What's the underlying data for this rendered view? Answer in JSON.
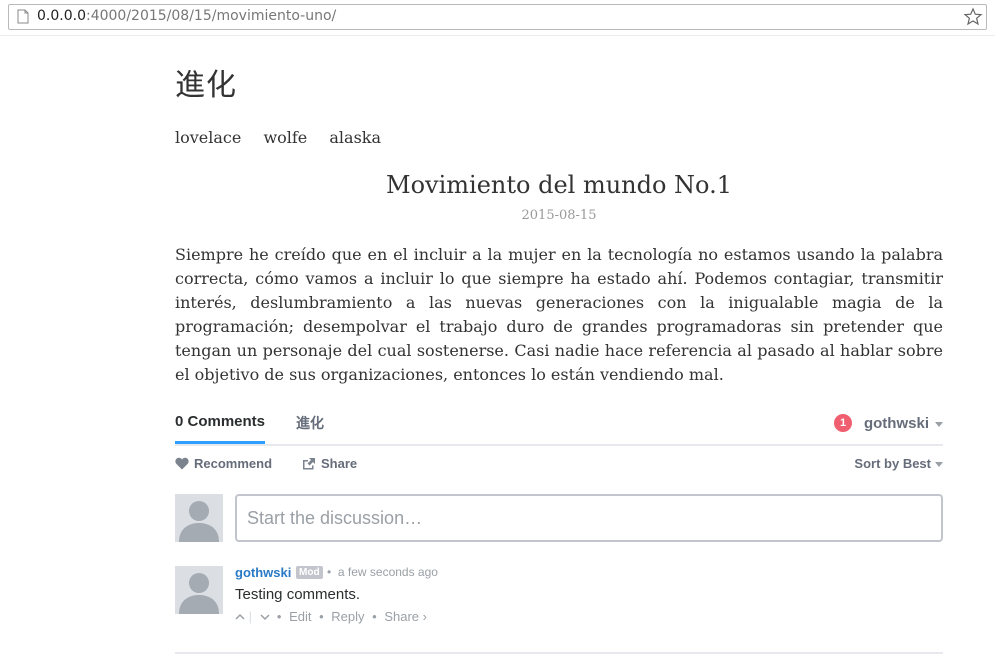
{
  "browser": {
    "url_host": "0.0.0.0",
    "url_rest": ":4000/2015/08/15/movimiento-uno/"
  },
  "blog": {
    "title": "進化",
    "nav": [
      "lovelace",
      "wolfe",
      "alaska"
    ]
  },
  "post": {
    "title": "Movimiento del mundo No.1",
    "date": "2015-08-15",
    "body": "Siempre he creído que en el incluir a la mujer en la tecnología no estamos usando la palabra correcta, cómo vamos a incluir lo que siempre ha estado ahí. Podemos contagiar, transmitir interés, deslumbramiento a las nuevas generaciones con la inigualable magia de la programación; desempolvar el trabajo duro de grandes programadoras sin pretender que tengan un personaje del cual sostenerse. Casi nadie hace referencia al pasado al hablar sobre el objetivo de sus organizaciones, entonces lo están vendiendo mal."
  },
  "comments": {
    "tab_comments": "0 Comments",
    "tab_community": "進化",
    "notification_count": "1",
    "user": "gothwski",
    "recommend": "Recommend",
    "share": "Share",
    "sort": "Sort by Best",
    "composer_placeholder": "Start the discussion…",
    "items": [
      {
        "author": "gothwski",
        "badge": "Mod",
        "time": "a few seconds ago",
        "text": "Testing comments.",
        "edit": "Edit",
        "reply": "Reply",
        "share": "Share ›"
      }
    ]
  },
  "colors": {
    "accent_blue": "#2e9fff",
    "link_blue": "#2a7ac6",
    "badge_red": "#f05f70"
  }
}
